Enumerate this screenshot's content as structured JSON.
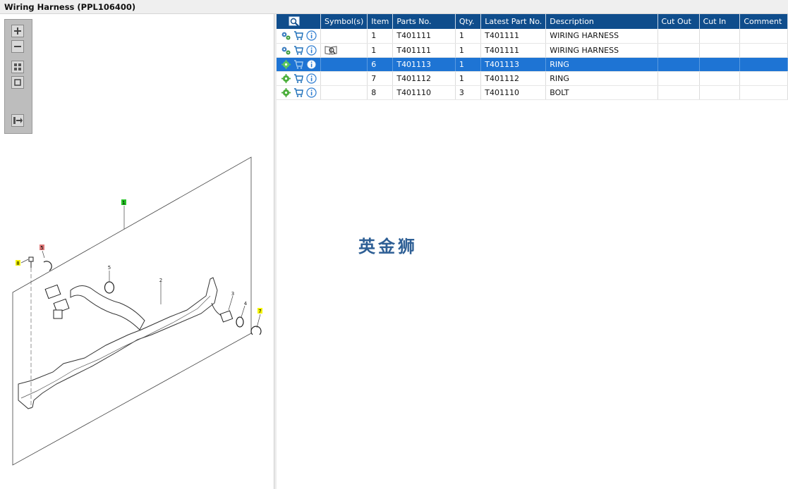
{
  "window": {
    "title": "Wiring Harness (PPL106400)"
  },
  "toolbar": {
    "tools": [
      {
        "name": "zoom-in-icon"
      },
      {
        "name": "zoom-out-icon"
      },
      {
        "name": "fit-grid-icon"
      },
      {
        "name": "actual-size-icon"
      },
      {
        "name": "export-icon"
      }
    ]
  },
  "diagram": {
    "callouts": {
      "c1": "1",
      "c2": "2",
      "c3": "3",
      "c4": "4",
      "c5": "5",
      "c5h": "5",
      "c7": "7",
      "c8": "8"
    },
    "callout_colors": {
      "green": "#27c427",
      "red": "#e07a7a",
      "yellow": "#f5f500"
    }
  },
  "table": {
    "columns": [
      "Symbol(s)",
      "Item",
      "Parts No.",
      "Qty.",
      "Latest Part No.",
      "Description",
      "Cut Out",
      "Cut In",
      "Comment"
    ],
    "rows": [
      {
        "symbol": "",
        "item": "1",
        "part": "T401111",
        "qty": "1",
        "latest": "T401111",
        "desc": "WIRING HARNESS",
        "cut_out": "",
        "cut_in": "",
        "comment": ""
      },
      {
        "symbol": "book-icon",
        "item": "1",
        "part": "T401111",
        "qty": "1",
        "latest": "T401111",
        "desc": "WIRING HARNESS",
        "cut_out": "",
        "cut_in": "",
        "comment": ""
      },
      {
        "symbol": "",
        "item": "6",
        "part": "T401113",
        "qty": "1",
        "latest": "T401113",
        "desc": "RING",
        "cut_out": "",
        "cut_in": "",
        "comment": ""
      },
      {
        "symbol": "",
        "item": "7",
        "part": "T401112",
        "qty": "1",
        "latest": "T401112",
        "desc": "RING",
        "cut_out": "",
        "cut_in": "",
        "comment": ""
      },
      {
        "symbol": "",
        "item": "8",
        "part": "T401110",
        "qty": "3",
        "latest": "T401110",
        "desc": "BOLT",
        "cut_out": "",
        "cut_in": "",
        "comment": ""
      }
    ],
    "selected_row": 2
  },
  "watermark": "英金狮",
  "colors": {
    "header": "#0f4d8c",
    "selected": "#1e74d4"
  }
}
